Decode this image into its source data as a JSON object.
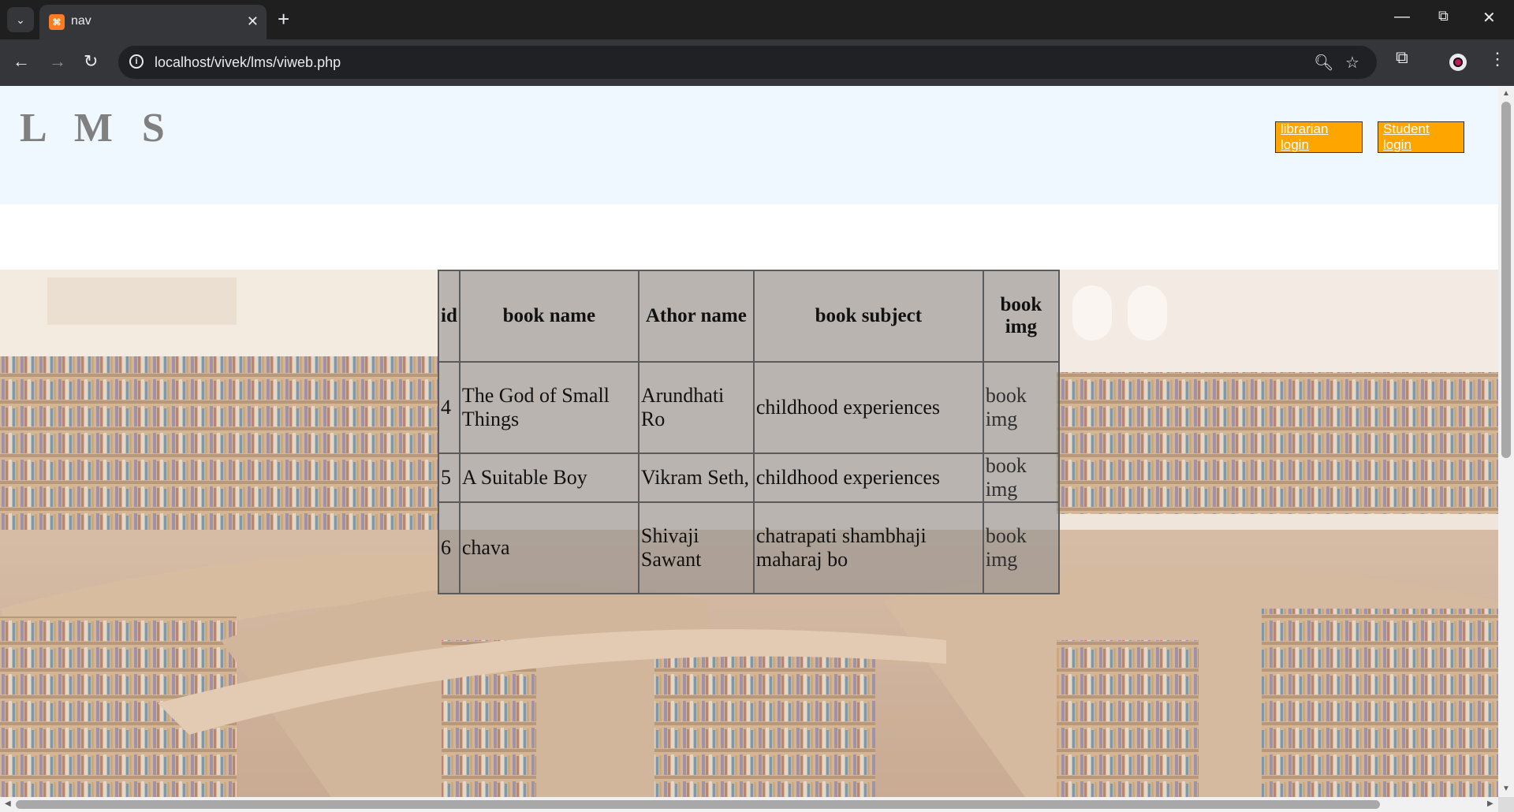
{
  "browser": {
    "tab_title": "nav",
    "url": "localhost/vivek/lms/viweb.php",
    "favicon": "xampp-icon"
  },
  "site": {
    "logo": "L M S",
    "buttons": {
      "librarian": "librarian login",
      "student": "Student login"
    }
  },
  "table": {
    "headers": {
      "id": "id",
      "book_name": "book name",
      "author": "Athor name",
      "subject": "book subject",
      "img": "book img"
    },
    "rows": [
      {
        "id": "4",
        "book_name": "The God of Small Things",
        "author": "Arundhati Ro",
        "subject": "childhood experiences",
        "img_alt": "book img"
      },
      {
        "id": "5",
        "book_name": "A Suitable Boy",
        "author": "Vikram Seth,",
        "subject": "childhood experiences",
        "img_alt": "book img"
      },
      {
        "id": "6",
        "book_name": "chava",
        "author": "Shivaji Sawant",
        "subject": "chatrapati shambhaji maharaj bo",
        "img_alt": "book img"
      }
    ]
  },
  "colors": {
    "nav_bg": "#f0f8ff",
    "button_bg": "#ffa500",
    "logo": "#808080"
  }
}
